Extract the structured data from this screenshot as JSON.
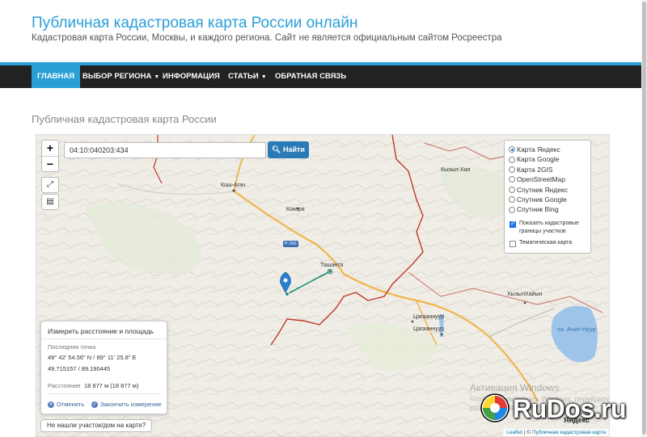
{
  "header": {
    "site_title": "Публичная кадастровая карта России онлайн",
    "site_description": "Кадастровая карта России, Москвы, и каждого региона. Сайт не является официальным сайтом Росреестра"
  },
  "nav": {
    "items": [
      {
        "label": "ГЛАВНАЯ"
      },
      {
        "label": "ВЫБОР РЕГИОНА"
      },
      {
        "label": "ИНФОРМАЦИЯ"
      },
      {
        "label": "СТАТЬИ"
      },
      {
        "label": "ОБРАТНАЯ СВЯЗЬ"
      }
    ]
  },
  "page": {
    "title": "Публичная кадастровая карта России"
  },
  "map": {
    "zoom_in": "+",
    "zoom_out": "−",
    "search_value": "04:10:040203:434",
    "search_button": "Найти",
    "layers": [
      {
        "label": "Карта Яндекс",
        "selected": true
      },
      {
        "label": "Карта Google",
        "selected": false
      },
      {
        "label": "Карта 2GIS",
        "selected": false
      },
      {
        "label": "OpenStreetMap",
        "selected": false
      },
      {
        "label": "Спутник Яндекс",
        "selected": false
      },
      {
        "label": "Спутник Google",
        "selected": false
      },
      {
        "label": "Спутник Bing",
        "selected": false
      }
    ],
    "show_boundaries": {
      "label": "Показать кадастровые границы участков",
      "checked": true
    },
    "thematic_map": {
      "label": "Тематическая карта",
      "checked": false
    },
    "place_labels": {
      "kosh_agach": "Кош-Агач",
      "kokorya": "Кокоря",
      "tashanta": "Ташанта",
      "tsagaannuur_1": "Цагааннуур",
      "tsagaannuur_2": "Цагааннуур",
      "kyzyl_khaya": "Кызыл-Хая",
      "khyzyl_khaiyn": "ХызылХайын",
      "road": "Р-256",
      "lake": "оз. Ачит-Нуур"
    },
    "measure": {
      "title": "Измерить расстояние и площадь",
      "last_point_label": "Последняя точка",
      "coord_dms": "49° 42' 54.56\" N / 89° 11' 25.8\" E",
      "coord_dec": "49.715157 / 89.190445",
      "distance_label": "Расстояние",
      "distance_value": "18 877 м (18 877 м)",
      "cancel": "Отменить",
      "finish": "Закончить измерение"
    },
    "not_found_button": "Не нашли участок/дом на карте?",
    "watermark_title": "Активация Windows",
    "watermark_text": "Чтобы активировать Windows, перейдите в раздел \"Параметры\".",
    "attribution_leaflet": "Leaflet",
    "attribution_pkk": "Публичная кадастровая карта",
    "yandex_label": "Яндекс"
  },
  "logo": {
    "text": "RuDos.ru"
  },
  "colors": {
    "accent": "#2a9fd6",
    "navbar": "#222222",
    "boundary": "#c0392b",
    "road": "#f0b44c",
    "measure_line": "#1a8f7a"
  }
}
